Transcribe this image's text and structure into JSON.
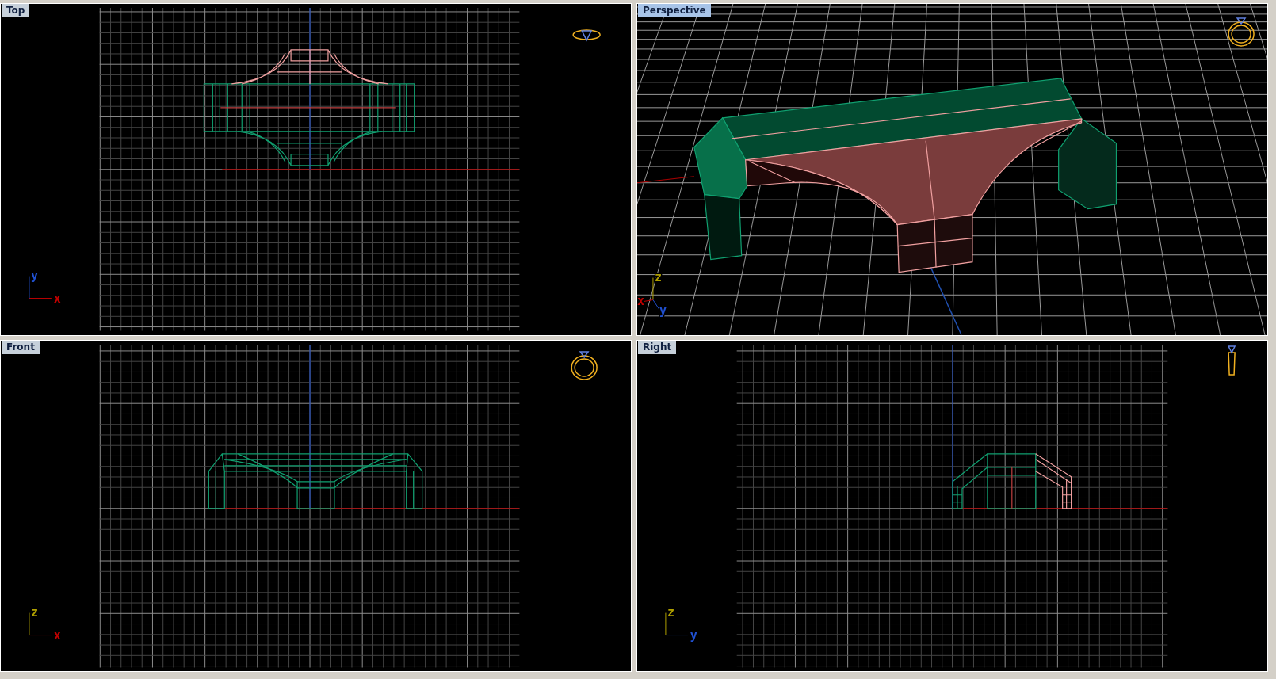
{
  "viewports": [
    {
      "kind": "top",
      "title": "Top",
      "selected": false,
      "axes": [
        {
          "label": "x",
          "color": "#c00000"
        },
        {
          "label": "y",
          "color": "#2050d0"
        }
      ]
    },
    {
      "kind": "perspective",
      "title": "Perspective",
      "selected": true,
      "axes": [
        {
          "label": "x",
          "color": "#c00000"
        },
        {
          "label": "y",
          "color": "#2050d0"
        },
        {
          "label": "z",
          "color": "#b0a000"
        }
      ]
    },
    {
      "kind": "front",
      "title": "Front",
      "selected": false,
      "axes": [
        {
          "label": "x",
          "color": "#c00000"
        },
        {
          "label": "z",
          "color": "#b0a000"
        }
      ]
    },
    {
      "kind": "right",
      "title": "Right",
      "selected": false,
      "axes": [
        {
          "label": "y",
          "color": "#2050d0"
        },
        {
          "label": "z",
          "color": "#b0a000"
        }
      ]
    }
  ]
}
